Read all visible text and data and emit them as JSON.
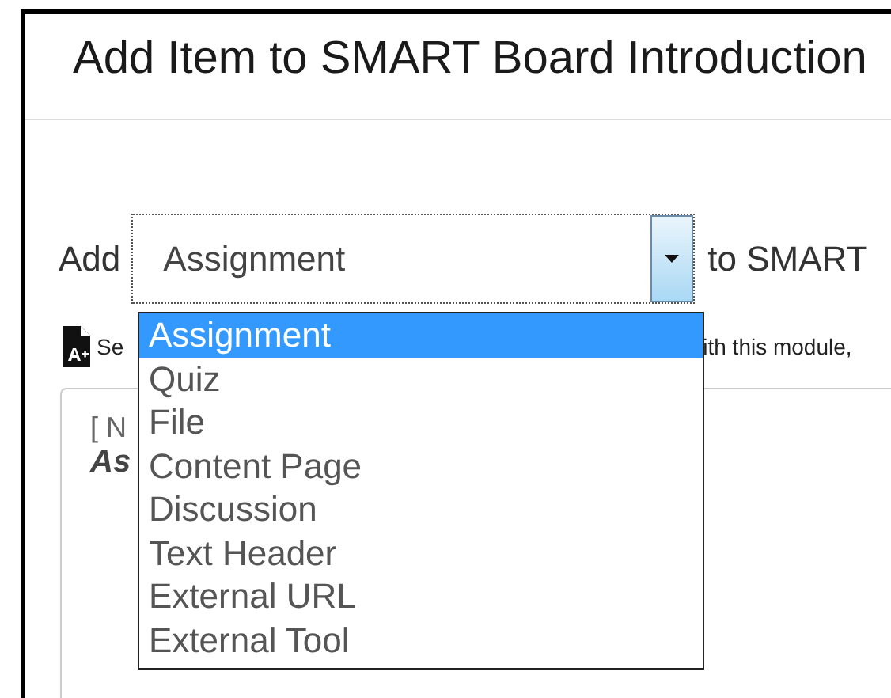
{
  "dialog": {
    "title": "Add Item to SMART Board Introduction"
  },
  "add_row": {
    "prefix": "Add",
    "select": {
      "value": "Assignment",
      "expanded": true
    },
    "suffix": "to SMART"
  },
  "dropdown": {
    "options": [
      {
        "label": "Assignment",
        "selected": true
      },
      {
        "label": "Quiz",
        "selected": false
      },
      {
        "label": "File",
        "selected": false
      },
      {
        "label": "Content Page",
        "selected": false
      },
      {
        "label": "Discussion",
        "selected": false
      },
      {
        "label": "Text Header",
        "selected": false
      },
      {
        "label": "External URL",
        "selected": false
      },
      {
        "label": "External Tool",
        "selected": false
      }
    ]
  },
  "hint": {
    "text_start": "Se",
    "text_end": "ith this module,"
  },
  "panel": {
    "line_1": "[ N",
    "line_2": "As"
  }
}
